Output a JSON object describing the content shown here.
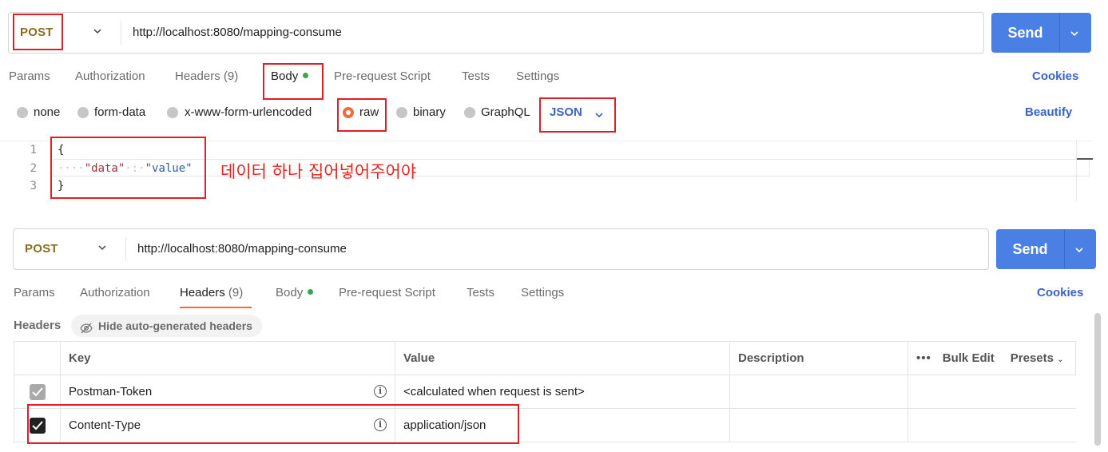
{
  "top": {
    "method": "POST",
    "url": "http://localhost:8080/mapping-consume",
    "send_label": "Send",
    "tabs": [
      {
        "label": "Params"
      },
      {
        "label": "Authorization"
      },
      {
        "label": "Headers",
        "count": "(9)"
      },
      {
        "label": "Body"
      },
      {
        "label": "Pre-request Script"
      },
      {
        "label": "Tests"
      },
      {
        "label": "Settings"
      }
    ],
    "cookies_label": "Cookies",
    "body_types": [
      {
        "label": "none"
      },
      {
        "label": "form-data"
      },
      {
        "label": "x-www-form-urlencoded"
      },
      {
        "label": "raw",
        "selected": true
      },
      {
        "label": "binary"
      },
      {
        "label": "GraphQL"
      }
    ],
    "raw_format": "JSON",
    "beautify_label": "Beautify",
    "code_lines": [
      {
        "num": "1",
        "text": "{"
      },
      {
        "num": "2",
        "indent": "····",
        "key": "\"data\"",
        "colon": "·:·",
        "value": "\"value\""
      },
      {
        "num": "3",
        "text": "}"
      }
    ],
    "annotation": "데이터 하나 집어넣어주어야"
  },
  "bottom": {
    "method": "POST",
    "url": "http://localhost:8080/mapping-consume",
    "send_label": "Send",
    "tabs": [
      {
        "label": "Params"
      },
      {
        "label": "Authorization"
      },
      {
        "label": "Headers",
        "count": "(9)"
      },
      {
        "label": "Body"
      },
      {
        "label": "Pre-request Script"
      },
      {
        "label": "Tests"
      },
      {
        "label": "Settings"
      }
    ],
    "cookies_label": "Cookies",
    "headers_title": "Headers",
    "hide_auto_label": "Hide auto-generated headers",
    "table": {
      "columns": {
        "key": "Key",
        "value": "Value",
        "description": "Description",
        "bulk_edit": "Bulk Edit",
        "presets": "Presets"
      },
      "rows": [
        {
          "key": "Postman-Token",
          "value": "<calculated when request is sent>",
          "description": ""
        },
        {
          "key": "Content-Type",
          "value": "application/json",
          "description": ""
        }
      ]
    }
  },
  "colors": {
    "accent": "#4a7fe3",
    "link": "#3b62c9",
    "method": "#8a6d1f",
    "highlight": "#dd2027",
    "active_tab": "#f26b3a"
  }
}
